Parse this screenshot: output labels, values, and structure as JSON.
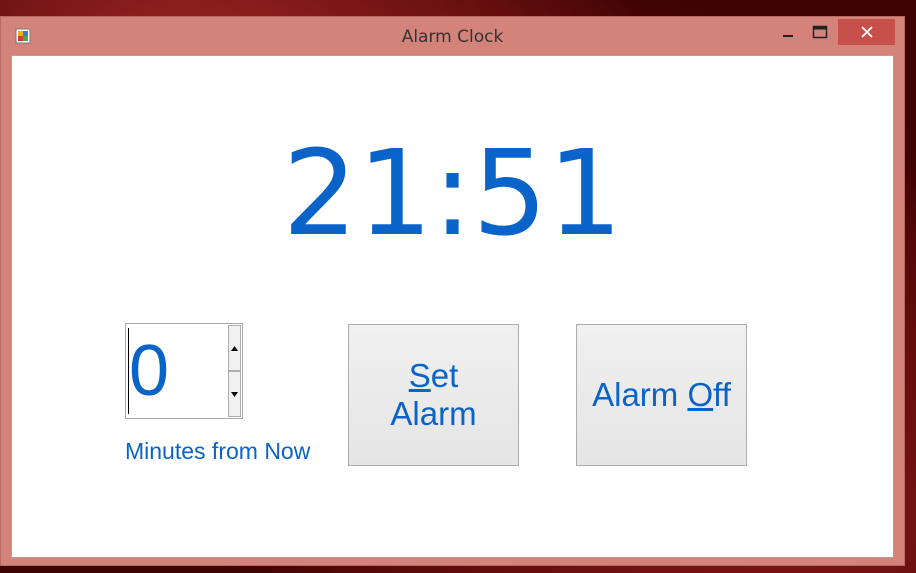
{
  "window": {
    "title": "Alarm Clock",
    "controls": {
      "minimize": "minimize",
      "maximize": "maximize",
      "close": "close"
    }
  },
  "clock": {
    "time": "21:51"
  },
  "spinner": {
    "value": "0",
    "label": "Minutes from Now"
  },
  "buttons": {
    "set_alarm": {
      "mnemonic": "S",
      "line1_rest": "et",
      "line2": "Alarm"
    },
    "alarm_off": {
      "prefix": "Alarm ",
      "mnemonic": "O",
      "rest": "ff"
    }
  },
  "colors": {
    "accent": "#0a63c9",
    "frame": "#d4837a",
    "close_button": "#c7504a",
    "client_background": "#ffffff"
  },
  "icons": {
    "app": "app-icon",
    "minimize": "minimize-icon",
    "maximize": "maximize-icon",
    "close": "close-icon",
    "spin_up": "arrow-up-icon",
    "spin_down": "arrow-down-icon"
  }
}
